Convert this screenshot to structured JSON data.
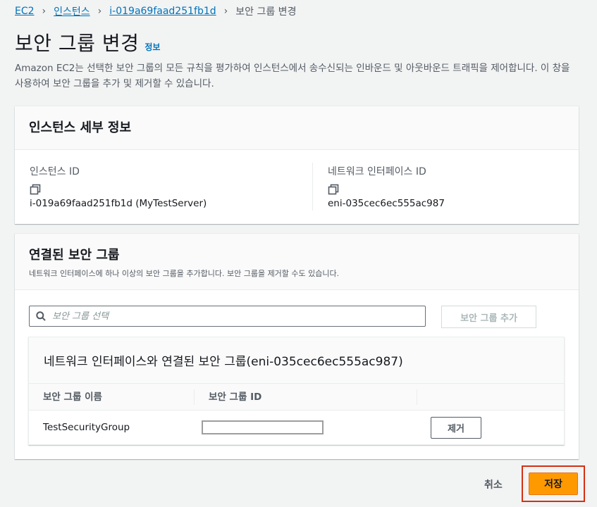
{
  "breadcrumb": {
    "items": [
      "EC2",
      "인스턴스",
      "i-019a69faad251fb1d"
    ],
    "current": "보안 그룹 변경"
  },
  "page": {
    "title": "보안 그룹 변경",
    "info_link": "정보",
    "description": "Amazon EC2는 선택한 보안 그룹의 모든 규칙을 평가하여 인스턴스에서 송수신되는 인바운드 및 아웃바운드 트래픽을 제어합니다. 이 창을 사용하여 보안 그룹을 추가 및 제거할 수 있습니다."
  },
  "instance_details": {
    "title": "인스턴스 세부 정보",
    "instance_id_label": "인스턴스 ID",
    "instance_id_value": "i-019a69faad251fb1d (MyTestServer)",
    "eni_label": "네트워크 인터페이스 ID",
    "eni_value": "eni-035cec6ec555ac987"
  },
  "associated_sg": {
    "title": "연결된 보안 그룹",
    "subtitle": "네트워크 인터페이스에 하나 이상의 보안 그룹을 추가합니다. 보안 그룹을 제거할 수도 있습니다.",
    "search_placeholder": "보안 그룹 선택",
    "add_button": "보안 그룹 추가",
    "table_title": "네트워크 인터페이스와 연결된 보안 그룹(eni-035cec6ec555ac987)",
    "columns": [
      "보안 그룹 이름",
      "보안 그룹 ID"
    ],
    "rows": [
      {
        "name": "TestSecurityGroup",
        "id": "",
        "action": "제거"
      }
    ]
  },
  "footer": {
    "cancel": "취소",
    "save": "저장"
  },
  "colors": {
    "link": "#0073bb",
    "primary": "#ff9900",
    "highlight": "#d13212"
  }
}
